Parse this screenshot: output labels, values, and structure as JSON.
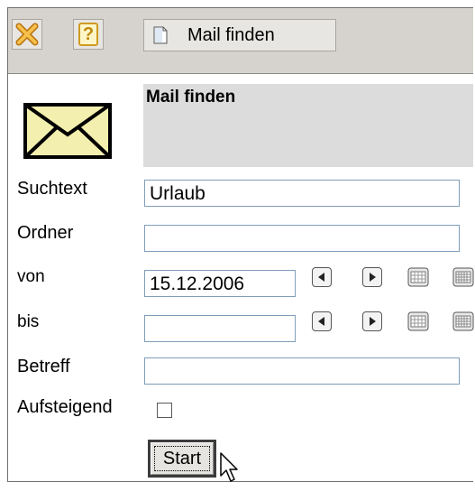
{
  "toolbar": {
    "close_icon": "close-icon",
    "help_icon": "help-icon",
    "help_glyph": "?",
    "tab_label": "Mail finden"
  },
  "header": {
    "title": "Mail finden",
    "envelope_icon": "envelope-icon"
  },
  "form": {
    "suchtext": {
      "label": "Suchtext",
      "value": "Urlaub"
    },
    "ordner": {
      "label": "Ordner",
      "value": ""
    },
    "von": {
      "label": "von",
      "value": "15.12.2006"
    },
    "bis": {
      "label": "bis",
      "value": ""
    },
    "betreff": {
      "label": "Betreff",
      "value": ""
    },
    "aufsteigend": {
      "label": "Aufsteigend",
      "checked": false
    },
    "start_label": "Start"
  },
  "colors": {
    "toolbar_bg": "#d6d3ce",
    "title_bg": "#dcdcdc",
    "input_border": "#7f9db9",
    "close_icon": "#f0a020"
  }
}
